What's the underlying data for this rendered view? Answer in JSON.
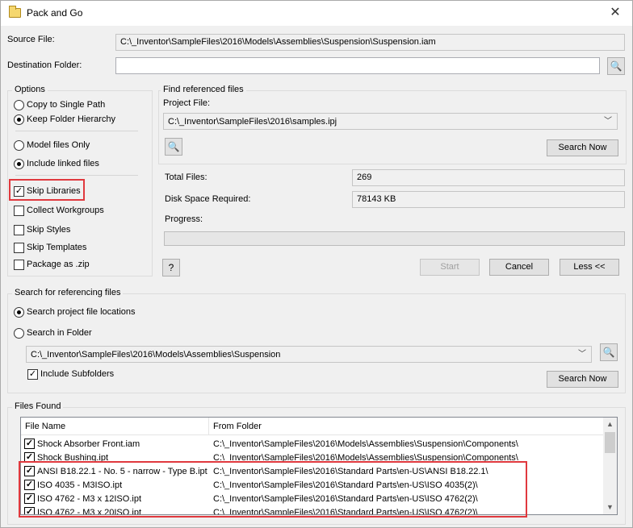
{
  "window": {
    "title": "Pack and Go",
    "close_glyph": "✕"
  },
  "source": {
    "label": "Source File:",
    "value": "C:\\_Inventor\\SampleFiles\\2016\\Models\\Assemblies\\Suspension\\Suspension.iam"
  },
  "destination": {
    "label": "Destination Folder:",
    "value": ""
  },
  "options": {
    "title": "Options",
    "copy_single": "Copy to Single Path",
    "keep_hierarchy": "Keep Folder Hierarchy",
    "model_only": "Model files Only",
    "include_linked": "Include linked files",
    "skip_libraries": "Skip Libraries",
    "collect_workgroups": "Collect Workgroups",
    "skip_styles": "Skip Styles",
    "skip_templates": "Skip Templates",
    "package_zip": "Package as .zip"
  },
  "find": {
    "title": "Find referenced files",
    "project_label": "Project File:",
    "project_value": "C:\\_Inventor\\SampleFiles\\2016\\samples.ipj",
    "search_now": "Search Now"
  },
  "stats": {
    "total_label": "Total Files:",
    "total_value": "269",
    "disk_label": "Disk Space Required:",
    "disk_value": "78143 KB",
    "progress_label": "Progress:",
    "progress_fraction": 0
  },
  "actions": {
    "start": "Start",
    "cancel": "Cancel",
    "less": "Less <<",
    "help_glyph": "?"
  },
  "referencing": {
    "title": "Search for referencing files",
    "search_project": "Search project file locations",
    "search_folder": "Search in Folder",
    "folder_value": "C:\\_Inventor\\SampleFiles\\2016\\Models\\Assemblies\\Suspension",
    "include_subfolders": "Include Subfolders",
    "search_now": "Search Now"
  },
  "files_found": {
    "title": "Files Found",
    "col_name": "File Name",
    "col_folder": "From Folder",
    "rows": [
      {
        "name": "Shock Absorber Front.iam",
        "folder": "C:\\_Inventor\\SampleFiles\\2016\\Models\\Assemblies\\Suspension\\Components\\"
      },
      {
        "name": "Shock Bushing.ipt",
        "folder": "C:\\_Inventor\\SampleFiles\\2016\\Models\\Assemblies\\Suspension\\Components\\"
      },
      {
        "name": "ANSI B18.22.1 - No. 5 - narrow - Type B.ipt",
        "folder": "C:\\_Inventor\\SampleFiles\\2016\\Standard Parts\\en-US\\ANSI B18.22.1\\"
      },
      {
        "name": "ISO 4035 - M3ISO.ipt",
        "folder": "C:\\_Inventor\\SampleFiles\\2016\\Standard Parts\\en-US\\ISO 4035(2)\\"
      },
      {
        "name": "ISO 4762 - M3 x 12ISO.ipt",
        "folder": "C:\\_Inventor\\SampleFiles\\2016\\Standard Parts\\en-US\\ISO 4762(2)\\"
      },
      {
        "name": "ISO 4762 - M3 x 20ISO.ipt",
        "folder": "C:\\_Inventor\\SampleFiles\\2016\\Standard Parts\\en-US\\ISO 4762(2)\\"
      }
    ]
  },
  "colors": {
    "highlight": "#e0393e"
  }
}
